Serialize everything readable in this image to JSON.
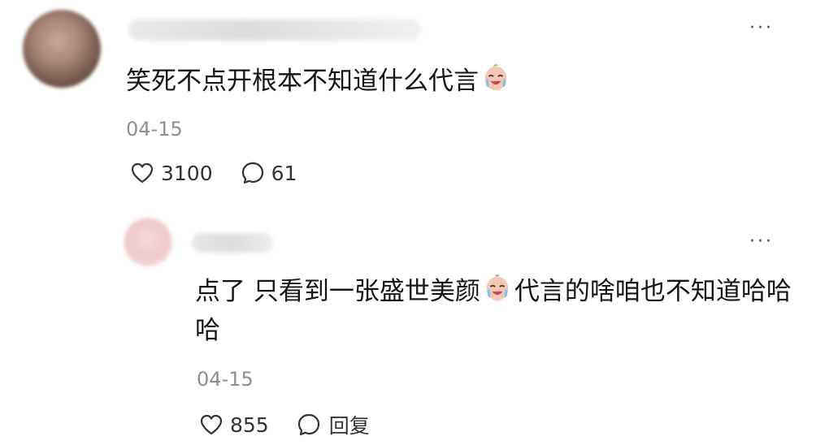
{
  "comment": {
    "text_before_emoji": "笑死不点开根本不知道什么代言",
    "emoji": "crying-laughing-emoji",
    "date": "04-15",
    "like_count": "3100",
    "reply_count": "61",
    "more_label": "···"
  },
  "reply": {
    "text_before_emoji": "点了 只看到一张盛世美颜",
    "emoji": "crying-laughing-emoji",
    "text_after_emoji": "代言的啥咱也不知道哈哈哈",
    "date": "04-15",
    "like_count": "855",
    "reply_label": "回复",
    "more_label": "···"
  },
  "colors": {
    "text": "#151515",
    "secondary": "#8f8f8f",
    "icon": "#333333"
  }
}
